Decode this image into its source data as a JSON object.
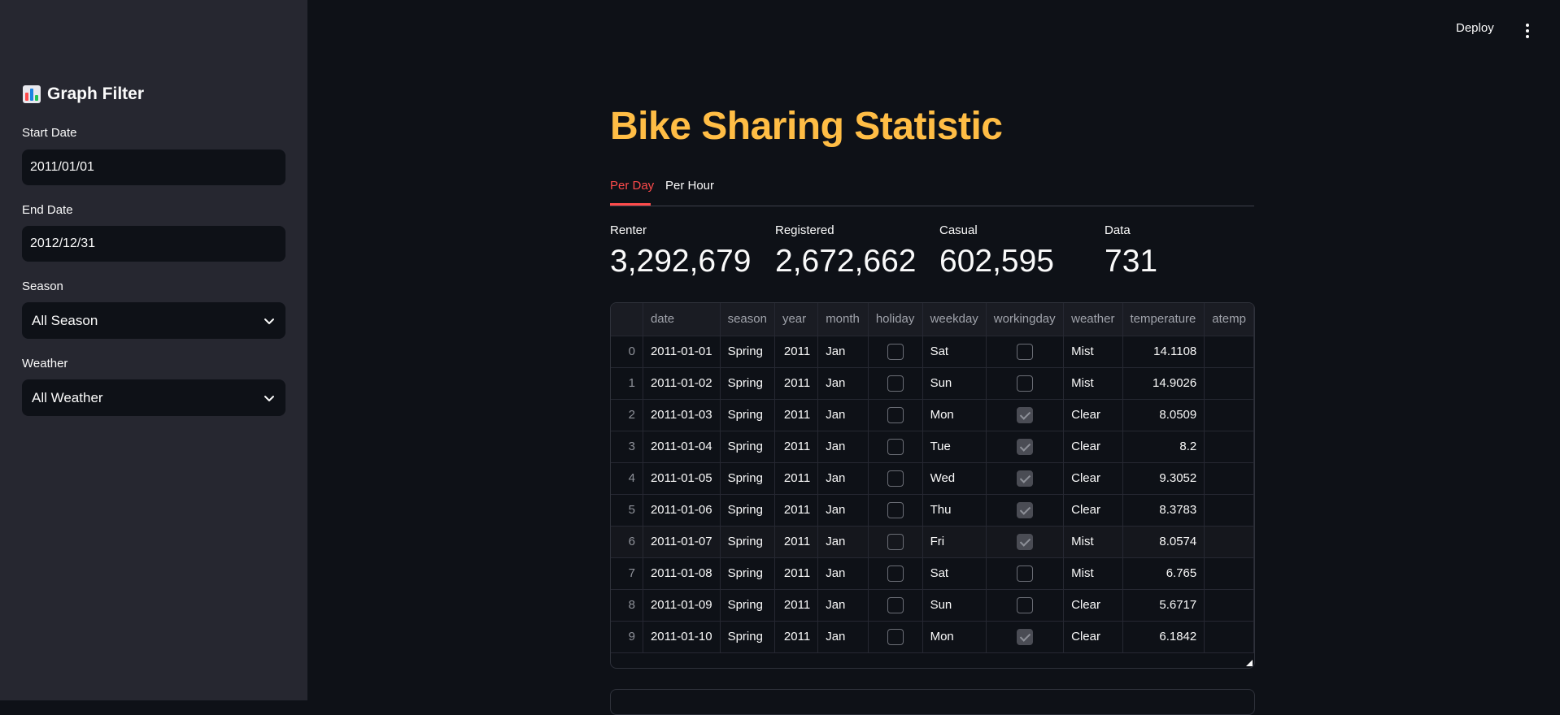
{
  "sidebar": {
    "title": "Graph Filter",
    "title_icon": "bar-chart-icon",
    "start_date": {
      "label": "Start Date",
      "value": "2011/01/01"
    },
    "end_date": {
      "label": "End Date",
      "value": "2012/12/31"
    },
    "season": {
      "label": "Season",
      "value": "All Season"
    },
    "weather": {
      "label": "Weather",
      "value": "All Weather"
    }
  },
  "header": {
    "deploy_label": "Deploy",
    "menu_icon": "kebab-menu-icon"
  },
  "main": {
    "title": "Bike Sharing Statistic",
    "tabs": [
      {
        "label": "Per Day",
        "active": true
      },
      {
        "label": "Per Hour",
        "active": false
      }
    ],
    "metrics": [
      {
        "label": "Renter",
        "value": "3,292,679"
      },
      {
        "label": "Registered",
        "value": "2,672,662"
      },
      {
        "label": "Casual",
        "value": "602,595"
      },
      {
        "label": "Data",
        "value": "731"
      }
    ],
    "table": {
      "columns": [
        "",
        "date",
        "season",
        "year",
        "month",
        "holiday",
        "weekday",
        "workingday",
        "weather",
        "temperature",
        "atemp"
      ],
      "rows": [
        [
          "0",
          "2011-01-01",
          "Spring",
          "2011",
          "Jan",
          false,
          "Sat",
          false,
          "Mist",
          "14.1108"
        ],
        [
          "1",
          "2011-01-02",
          "Spring",
          "2011",
          "Jan",
          false,
          "Sun",
          false,
          "Mist",
          "14.9026"
        ],
        [
          "2",
          "2011-01-03",
          "Spring",
          "2011",
          "Jan",
          false,
          "Mon",
          true,
          "Clear",
          "8.0509"
        ],
        [
          "3",
          "2011-01-04",
          "Spring",
          "2011",
          "Jan",
          false,
          "Tue",
          true,
          "Clear",
          "8.2"
        ],
        [
          "4",
          "2011-01-05",
          "Spring",
          "2011",
          "Jan",
          false,
          "Wed",
          true,
          "Clear",
          "9.3052"
        ],
        [
          "5",
          "2011-01-06",
          "Spring",
          "2011",
          "Jan",
          false,
          "Thu",
          true,
          "Clear",
          "8.3783"
        ],
        [
          "6",
          "2011-01-07",
          "Spring",
          "2011",
          "Jan",
          false,
          "Fri",
          true,
          "Mist",
          "8.0574"
        ],
        [
          "7",
          "2011-01-08",
          "Spring",
          "2011",
          "Jan",
          false,
          "Sat",
          false,
          "Mist",
          "6.765"
        ],
        [
          "8",
          "2011-01-09",
          "Spring",
          "2011",
          "Jan",
          false,
          "Sun",
          false,
          "Clear",
          "5.6717"
        ],
        [
          "9",
          "2011-01-10",
          "Spring",
          "2011",
          "Jan",
          false,
          "Mon",
          true,
          "Clear",
          "6.1842"
        ]
      ]
    }
  },
  "colors": {
    "background": "#0e1117",
    "sidebar": "#262730",
    "title_accent": "#ffbd45",
    "active_tab": "#ff4b4b"
  }
}
